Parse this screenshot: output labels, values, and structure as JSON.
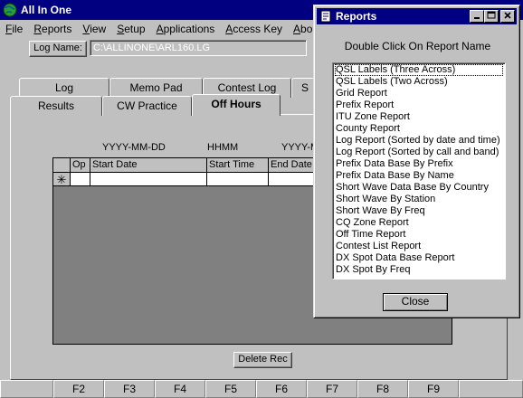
{
  "app": {
    "title": "All In One"
  },
  "menu": [
    "File",
    "Reports",
    "View",
    "Setup",
    "Applications",
    "Access Key",
    "About",
    "H"
  ],
  "log_name": {
    "button": "Log Name:",
    "value": "C:\\ALLINONE\\ARL160.LG"
  },
  "tabs_back": [
    "Log",
    "Memo Pad",
    "Contest Log",
    "S"
  ],
  "tabs_front": [
    "Results",
    "CW Practice",
    "Off Hours"
  ],
  "active_tab": "Off Hours",
  "format_labels": [
    "YYYY-MM-DD",
    "HHMM",
    "YYYY-M"
  ],
  "grid": {
    "columns": [
      "Op",
      "Start Date",
      "Start Time",
      "End Date"
    ],
    "new_row_marker": "✳"
  },
  "delete_button": "Delete Rec",
  "function_keys": [
    "",
    "F2",
    "F3",
    "F4",
    "F5",
    "F6",
    "F7",
    "F8",
    "F9",
    ""
  ],
  "dialog": {
    "title": "Reports",
    "instruction": "Double Click On Report Name",
    "reports": [
      "QSL Labels (Three Across)",
      "QSL Labels (Two Across)",
      "Grid Report",
      "Prefix Report",
      "ITU Zone Report",
      "County Report",
      "Log Report (Sorted by date and time)",
      "Log Report (Sorted by call and band)",
      "Prefix Data Base By Prefix",
      "Prefix Data Base By Name",
      "Short Wave Data Base By Country",
      "Short Wave By Station",
      "Short Wave By Freq",
      "CQ Zone Report",
      "Off Time Report",
      "Contest List Report",
      "DX Spot Data Base Report",
      "DX Spot By Freq"
    ],
    "close_button": "Close"
  },
  "colors": {
    "titlebar": "#000080",
    "face": "#c0c0c0",
    "grid_bg": "#808080"
  },
  "icons": {
    "app": "globe-icon",
    "dialog": "report-icon",
    "minimize": "minimize-icon",
    "maximize": "maximize-icon",
    "close": "close-icon"
  }
}
